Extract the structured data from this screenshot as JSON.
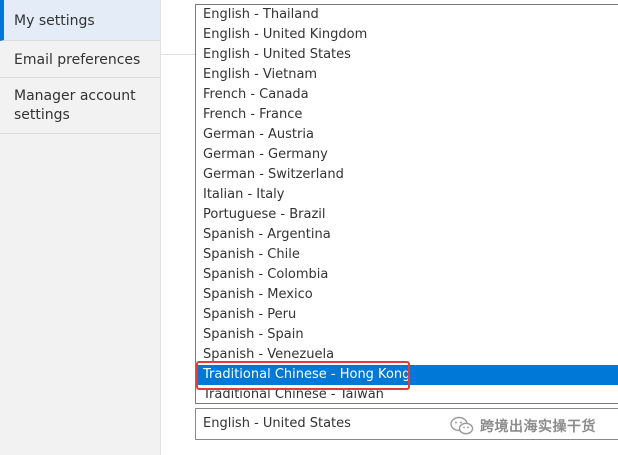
{
  "sidebar": {
    "items": [
      {
        "label": "My settings"
      },
      {
        "label": "Email preferences"
      },
      {
        "label": "Manager account settings"
      }
    ]
  },
  "language_dropdown": {
    "options": [
      "English - Thailand",
      "English - United Kingdom",
      "English - United States",
      "English - Vietnam",
      "French - Canada",
      "French - France",
      "German - Austria",
      "German - Germany",
      "German - Switzerland",
      "Italian - Italy",
      "Portuguese - Brazil",
      "Spanish - Argentina",
      "Spanish - Chile",
      "Spanish - Colombia",
      "Spanish - Mexico",
      "Spanish - Peru",
      "Spanish - Spain",
      "Spanish - Venezuela",
      "Traditional Chinese - Hong Kong",
      "Traditional Chinese - Taiwan"
    ],
    "highlighted": "Traditional Chinese - Hong Kong",
    "selected_value": "English - United States"
  },
  "watermark": {
    "text": "跨境出海实操干货"
  },
  "colors": {
    "highlight_blue": "#0078d7",
    "annotation_red": "#e23b3b",
    "sidebar_active_accent": "#0078d4"
  }
}
